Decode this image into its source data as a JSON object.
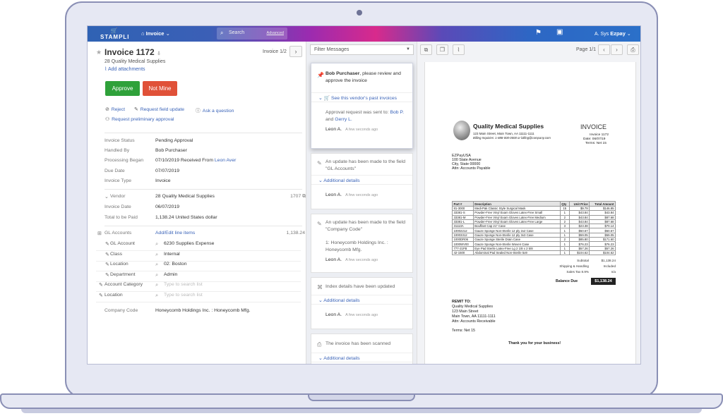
{
  "app": {
    "logo": "STAMPLI",
    "nav_label": "Invoice",
    "search_placeholder": "Search",
    "search_advanced": "Advanced",
    "user_prefix": "A. Sys",
    "user_name": "Ezpay"
  },
  "invoice": {
    "title": "Invoice 1172",
    "vendor_line": "28 Quality Medical Supplies",
    "add_attachments": "Add attachments",
    "count": "Invoice 1/2",
    "approve": "Approve",
    "not_mine": "Not Mine",
    "actions": {
      "reject": "Reject",
      "request_update": "Request field update",
      "ask_question": "Ask a question",
      "preliminary": "Request preliminary approval"
    },
    "fields": [
      {
        "label": "Invoice Status",
        "value": "Pending Approval"
      },
      {
        "label": "Handled By",
        "value": "Bob Purchaser"
      },
      {
        "label": "Processing Began",
        "value": "07/10/2019 Received From",
        "link": "Leon Aver"
      },
      {
        "label": "Due Date",
        "value": "07/07/2019"
      },
      {
        "label": "Invoice Type",
        "value": "Invoice"
      }
    ],
    "vendor_row": {
      "label": "Vendor",
      "value": "28 Quality Medical Supplies",
      "id": "1707"
    },
    "invoice_date": {
      "label": "Invoice Date",
      "value": "06/07/2019"
    },
    "total": {
      "label": "Total to be Paid",
      "value": "1,138.24 United States dollar"
    },
    "gl_header": {
      "label": "GL Accounts",
      "link": "Add/Edit line items",
      "amount": "1,138.24"
    },
    "gl_rows": [
      {
        "label": "GL Account",
        "value": "6230 Supplies Expense",
        "placeholder": ""
      },
      {
        "label": "Class",
        "value": "Internal",
        "placeholder": ""
      },
      {
        "label": "Location",
        "value": "02: Boston",
        "placeholder": ""
      },
      {
        "label": "Department",
        "value": "Admin",
        "placeholder": ""
      },
      {
        "label": "Account Category",
        "value": "",
        "placeholder": "Type to search list"
      },
      {
        "label": "Location",
        "value": "",
        "placeholder": "Type to search list"
      }
    ],
    "company_code": {
      "label": "Company Code",
      "value": "Honeycomb Holdings Inc. : Honeycomb Mfg."
    }
  },
  "messages": {
    "filter": "Filter Messages",
    "items": [
      {
        "name": "Bob Purchaser",
        "text": ", please review and approve the invoice",
        "past_link": "See this vendor's past invoices",
        "sent_text": "Approval request was sent to:",
        "recipients": "Bob P.",
        "recipients2": "Gerry L.",
        "and": "and",
        "author": "Leon A.",
        "time": "A few seconds ago"
      },
      {
        "text": "An update has been made to the field \"GL Accounts\"",
        "additional": "Additional details",
        "author": "Leon A.",
        "time": "A few seconds ago"
      },
      {
        "text": "An update has been made to the field \"Company Code\"",
        "detail": "1: Honeycomb Holdings Inc. : Honeycomb Mfg.",
        "author": "Leon A.",
        "time": "A few seconds ago"
      },
      {
        "text": "Index details have been updated",
        "additional": "Additional details",
        "author": "Leon A.",
        "time": "A few seconds ago"
      },
      {
        "text": "The invoice has been scanned",
        "additional": "Additional details"
      }
    ]
  },
  "viewer": {
    "page": "Page 1/1"
  },
  "document": {
    "company": "Quality Medical Supplies",
    "address": "123 Main Street, Main Town, AA 11111-1111",
    "billing": "Billing Inquiries: 1-888-000-0000 or billing@company.com",
    "heading": "INVOICE",
    "inv_no": "Invoice 1172",
    "date": "Date: 06/07/19",
    "terms": "Terms: Net 15",
    "bill_to": [
      "EZPayUSA",
      "100 State Avenue",
      "City, State 00000",
      "Attn: Accounts Payable"
    ],
    "columns": [
      "Part #",
      "Description",
      "Qty",
      "Unit Price",
      "Total Amount"
    ],
    "lines": [
      [
        "81-3000",
        "Medi-Pak Classic Style Surgical Mask",
        "15",
        "$9.79",
        "$146.85"
      ],
      [
        "33381-S",
        "Powder-Free Vinyl Exam Gloves Latex-Free Small",
        "1",
        "$43.84",
        "$43.84"
      ],
      [
        "33381-M",
        "Powder-Free Vinyl Exam Gloves Latex-Free Medium",
        "2",
        "$43.84",
        "$87.68"
      ],
      [
        "33381-L",
        "Powder-Free Vinyl Exam Gloves Latex-Free Large",
        "2",
        "$43.84",
        "$87.68"
      ],
      [
        "31113A",
        "Bouffant Cap 21\" Case",
        "3",
        "$23.38",
        "$70.14"
      ],
      [
        "10002212",
        "Gauze Sponge Non-Sterile 12 ply 2x2 Case",
        "1",
        "$50.67",
        "$50.67"
      ],
      [
        "10003312",
        "Gauze Sponge Non-Sterile 12 ply 3x3 Case",
        "1",
        "$59.05",
        "$59.05"
      ],
      [
        "1000DR06",
        "Gauze Sponge Sterile Drain Case",
        "2",
        "$85.80",
        "$171.60"
      ],
      [
        "1000WV00",
        "Gauze Sponge Non-Sterile Woven Case",
        "1",
        "$76.23",
        "$76.23"
      ],
      [
        "777-21FB",
        "Eye Pad Sterile Latex-Free Lg 2 1/8 x 2 5/8",
        "1",
        "$57.26",
        "$57.26"
      ],
      [
        "42-1500",
        "Abdominal Pad Sealed Non-Sterile 5x9",
        "1",
        "$104.62",
        "$104.62"
      ]
    ],
    "totals": [
      {
        "label": "Subtotal",
        "value": "$1,138.24"
      },
      {
        "label": "Shipping & Handling",
        "value": "Included"
      },
      {
        "label": "Sales Tax 8.9%",
        "value": "n/a"
      }
    ],
    "balance_label": "Balance Due",
    "balance_value": "$1,138.24",
    "remit_title": "REMIT TO:",
    "remit": [
      "Quality Medical Supplies",
      "123 Main Street",
      "Main Town, AA 11111-1111",
      "Attn: Accounts Receivable"
    ],
    "remit_terms": "Terms: Net 15",
    "thanks": "Thank you for your business!"
  }
}
